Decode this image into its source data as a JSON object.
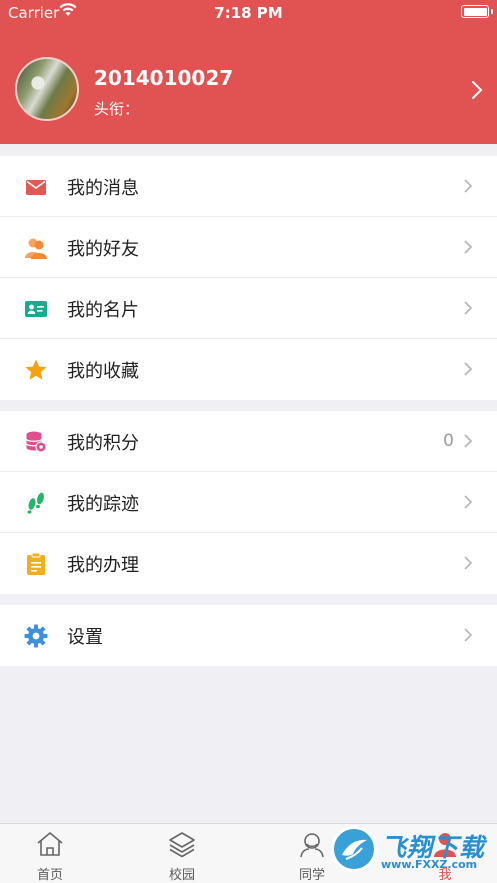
{
  "status_bar": {
    "carrier": "Carrier",
    "time": "7:18 PM"
  },
  "profile": {
    "username": "2014010027",
    "title_label": "头衔："
  },
  "menu_groups": [
    {
      "items": [
        {
          "label": "我的消息",
          "icon": "mail-icon",
          "color": "#e05a55"
        },
        {
          "label": "我的好友",
          "icon": "friends-icon",
          "color": "#f08a3a"
        },
        {
          "label": "我的名片",
          "icon": "id-card-icon",
          "color": "#1aaa8e"
        },
        {
          "label": "我的收藏",
          "icon": "star-icon",
          "color": "#f5a20b"
        }
      ]
    },
    {
      "items": [
        {
          "label": "我的积分",
          "icon": "coins-icon",
          "color": "#e04f8b",
          "value": "0"
        },
        {
          "label": "我的踪迹",
          "icon": "footprint-icon",
          "color": "#2bb36b"
        },
        {
          "label": "我的办理",
          "icon": "clipboard-icon",
          "color": "#f4ad1b"
        }
      ]
    },
    {
      "items": [
        {
          "label": "设置",
          "icon": "gear-icon",
          "color": "#3e8fdc"
        }
      ]
    }
  ],
  "tabs": [
    {
      "label": "首页",
      "icon": "home-icon"
    },
    {
      "label": "校园",
      "icon": "layers-icon"
    },
    {
      "label": "同学",
      "icon": "classmates-icon"
    },
    {
      "label": "我",
      "icon": "me-icon",
      "active": true
    }
  ],
  "watermark": {
    "title": "飞翔下载",
    "url": "www.FXXZ.com"
  },
  "colors": {
    "accent": "#e05352",
    "background": "#efeff4"
  }
}
